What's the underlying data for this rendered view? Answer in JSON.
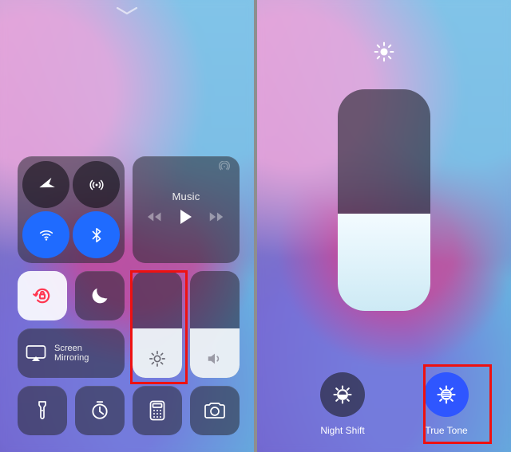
{
  "media": {
    "title": "Music"
  },
  "mirror": {
    "line1": "Screen",
    "line2": "Mirroring"
  },
  "brightness": {
    "fill_percent": 46
  },
  "volume": {
    "fill_percent": 46
  },
  "expanded": {
    "brightness_percent": 44,
    "night_shift": {
      "label": "Night Shift",
      "enabled": false
    },
    "true_tone": {
      "label": "True Tone",
      "enabled": true
    }
  }
}
